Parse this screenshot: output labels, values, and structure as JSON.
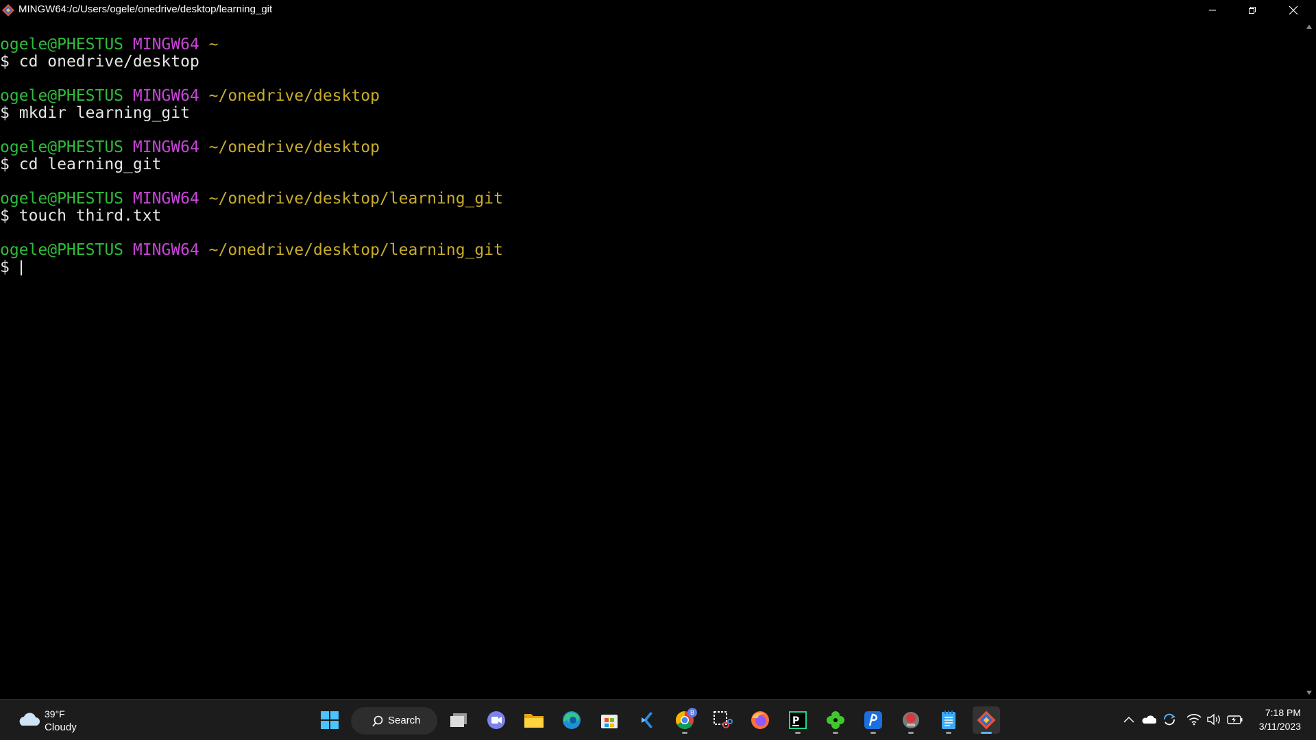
{
  "window": {
    "title": "MINGW64:/c/Users/ogele/onedrive/desktop/learning_git"
  },
  "terminal": {
    "blocks": [
      {
        "user": "ogele@PHESTUS",
        "sys": "MINGW64",
        "path": "~",
        "prompt": "$",
        "command": "cd onedrive/desktop"
      },
      {
        "user": "ogele@PHESTUS",
        "sys": "MINGW64",
        "path": "~/onedrive/desktop",
        "prompt": "$",
        "command": "mkdir learning_git"
      },
      {
        "user": "ogele@PHESTUS",
        "sys": "MINGW64",
        "path": "~/onedrive/desktop",
        "prompt": "$",
        "command": "cd learning_git"
      },
      {
        "user": "ogele@PHESTUS",
        "sys": "MINGW64",
        "path": "~/onedrive/desktop/learning_git",
        "prompt": "$",
        "command": "touch third.txt"
      },
      {
        "user": "ogele@PHESTUS",
        "sys": "MINGW64",
        "path": "~/onedrive/desktop/learning_git",
        "prompt": "$",
        "command": ""
      }
    ],
    "colors": {
      "user": "#2ebd3a",
      "sys": "#c845d8",
      "path": "#c9ad2a",
      "text": "#e6e6e6"
    }
  },
  "taskbar": {
    "weather": {
      "temp": "39°F",
      "condition": "Cloudy",
      "icon": "cloud-icon"
    },
    "search_label": "Search",
    "apps": [
      {
        "name": "start",
        "icon": "windows-logo-icon"
      },
      {
        "name": "task-view",
        "icon": "task-view-icon"
      },
      {
        "name": "teams-chat",
        "icon": "chat-video-icon"
      },
      {
        "name": "file-explorer",
        "icon": "folder-icon"
      },
      {
        "name": "edge",
        "icon": "edge-browser-icon"
      },
      {
        "name": "store",
        "icon": "store-icon"
      },
      {
        "name": "vscode",
        "icon": "code-icon"
      },
      {
        "name": "chrome",
        "icon": "chrome-icon",
        "badge": "B"
      },
      {
        "name": "snipping",
        "icon": "snipping-tool-icon"
      },
      {
        "name": "firefox",
        "icon": "firefox-icon"
      },
      {
        "name": "pycharm",
        "icon": "pycharm-icon"
      },
      {
        "name": "app-green",
        "icon": "clover-icon"
      },
      {
        "name": "app-blue",
        "icon": "blue-app-icon"
      },
      {
        "name": "app-red",
        "icon": "red-app-icon"
      },
      {
        "name": "notepad",
        "icon": "notepad-icon"
      },
      {
        "name": "git-bash",
        "icon": "git-icon"
      }
    ],
    "clock": {
      "time": "7:18 PM",
      "date": "3/11/2023"
    }
  }
}
